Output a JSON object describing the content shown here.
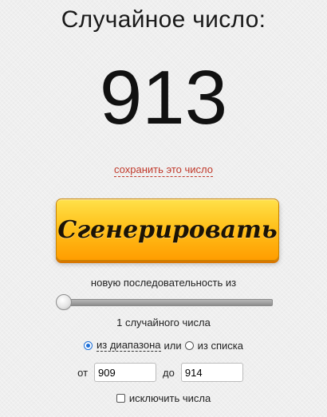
{
  "title": "Случайное число:",
  "random_number": "913",
  "save_link": "сохранить это число",
  "generate_button": "Сгенерировать",
  "sequence_label": "новую последовательность из",
  "slider": {
    "value": 1
  },
  "count_label": "1 случайного числа",
  "mode": {
    "range_label": "из диапазона",
    "or_label": "или",
    "list_label": "из списка",
    "selected": "range"
  },
  "range": {
    "from_label": "от",
    "from_value": "909",
    "to_label": "до",
    "to_value": "914"
  },
  "exclude_label": "исключить числа",
  "colors": {
    "background": "#efefef",
    "link": "#c0392b",
    "button_top": "#ffe14a",
    "button_bottom": "#ff9d00",
    "radio_accent": "#1d6fd8"
  }
}
